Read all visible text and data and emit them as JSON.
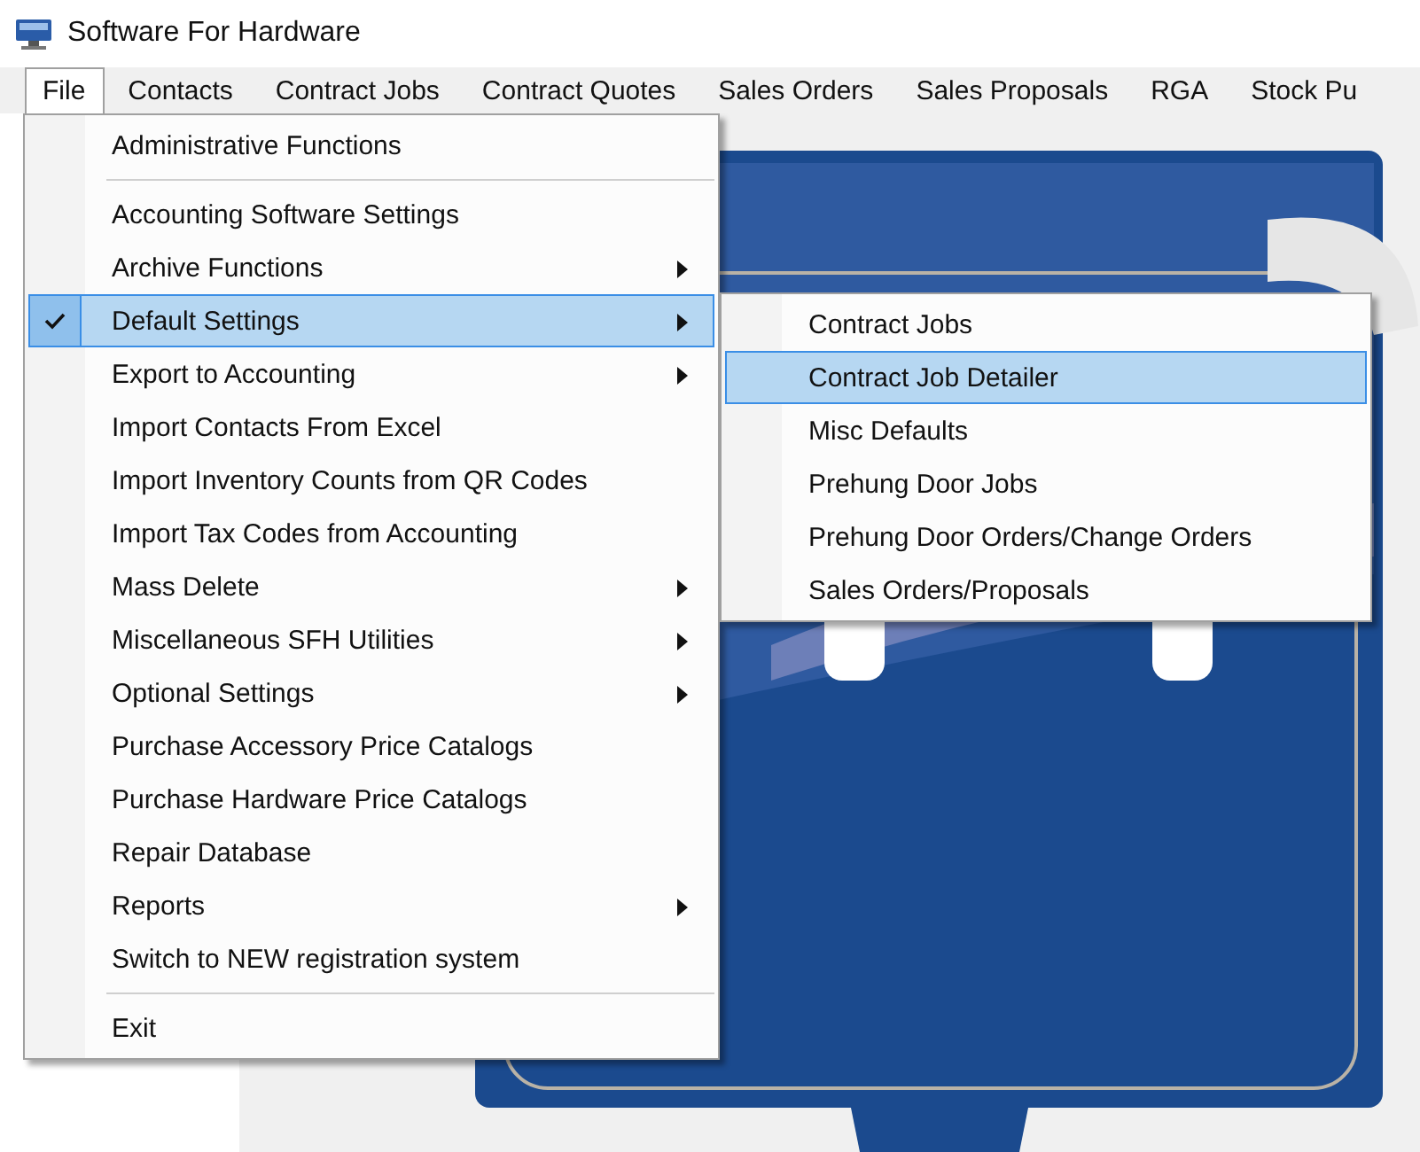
{
  "window": {
    "title": "Software For Hardware"
  },
  "menu_bar": [
    {
      "label": "File",
      "selected": true
    },
    {
      "label": "Contacts",
      "selected": false
    },
    {
      "label": "Contract Jobs",
      "selected": false
    },
    {
      "label": "Contract Quotes",
      "selected": false
    },
    {
      "label": "Sales Orders",
      "selected": false
    },
    {
      "label": "Sales Proposals",
      "selected": false
    },
    {
      "label": "RGA",
      "selected": false
    },
    {
      "label": "Stock Pu",
      "selected": false
    }
  ],
  "file_menu": [
    {
      "kind": "item",
      "label": "Administrative Functions",
      "has_submenu": false,
      "checked": false,
      "selected": false
    },
    {
      "kind": "separator"
    },
    {
      "kind": "item",
      "label": "Accounting Software Settings",
      "has_submenu": false,
      "checked": false,
      "selected": false
    },
    {
      "kind": "item",
      "label": "Archive Functions",
      "has_submenu": true,
      "checked": false,
      "selected": false
    },
    {
      "kind": "item",
      "label": "Default Settings",
      "has_submenu": true,
      "checked": true,
      "selected": true
    },
    {
      "kind": "item",
      "label": "Export to Accounting",
      "has_submenu": true,
      "checked": false,
      "selected": false
    },
    {
      "kind": "item",
      "label": "Import Contacts From Excel",
      "has_submenu": false,
      "checked": false,
      "selected": false
    },
    {
      "kind": "item",
      "label": "Import Inventory Counts from QR Codes",
      "has_submenu": false,
      "checked": false,
      "selected": false
    },
    {
      "kind": "item",
      "label": "Import Tax Codes from Accounting",
      "has_submenu": false,
      "checked": false,
      "selected": false
    },
    {
      "kind": "item",
      "label": "Mass Delete",
      "has_submenu": true,
      "checked": false,
      "selected": false
    },
    {
      "kind": "item",
      "label": "Miscellaneous SFH Utilities",
      "has_submenu": true,
      "checked": false,
      "selected": false
    },
    {
      "kind": "item",
      "label": "Optional Settings",
      "has_submenu": true,
      "checked": false,
      "selected": false
    },
    {
      "kind": "item",
      "label": "Purchase Accessory Price Catalogs",
      "has_submenu": false,
      "checked": false,
      "selected": false
    },
    {
      "kind": "item",
      "label": "Purchase Hardware Price Catalogs",
      "has_submenu": false,
      "checked": false,
      "selected": false
    },
    {
      "kind": "item",
      "label": "Repair Database",
      "has_submenu": false,
      "checked": false,
      "selected": false
    },
    {
      "kind": "item",
      "label": "Reports",
      "has_submenu": true,
      "checked": false,
      "selected": false
    },
    {
      "kind": "item",
      "label": "Switch to NEW registration system",
      "has_submenu": false,
      "checked": false,
      "selected": false
    },
    {
      "kind": "separator"
    },
    {
      "kind": "item",
      "label": "Exit",
      "has_submenu": false,
      "checked": false,
      "selected": false
    }
  ],
  "default_settings_submenu": [
    {
      "label": "Contract Jobs",
      "selected": false
    },
    {
      "label": "Contract Job Detailer",
      "selected": true
    },
    {
      "label": "Misc Defaults",
      "selected": false
    },
    {
      "label": "Prehung Door Jobs",
      "selected": false
    },
    {
      "label": "Prehung Door Orders/Change Orders",
      "selected": false
    },
    {
      "label": "Sales Orders/Proposals",
      "selected": false
    }
  ]
}
